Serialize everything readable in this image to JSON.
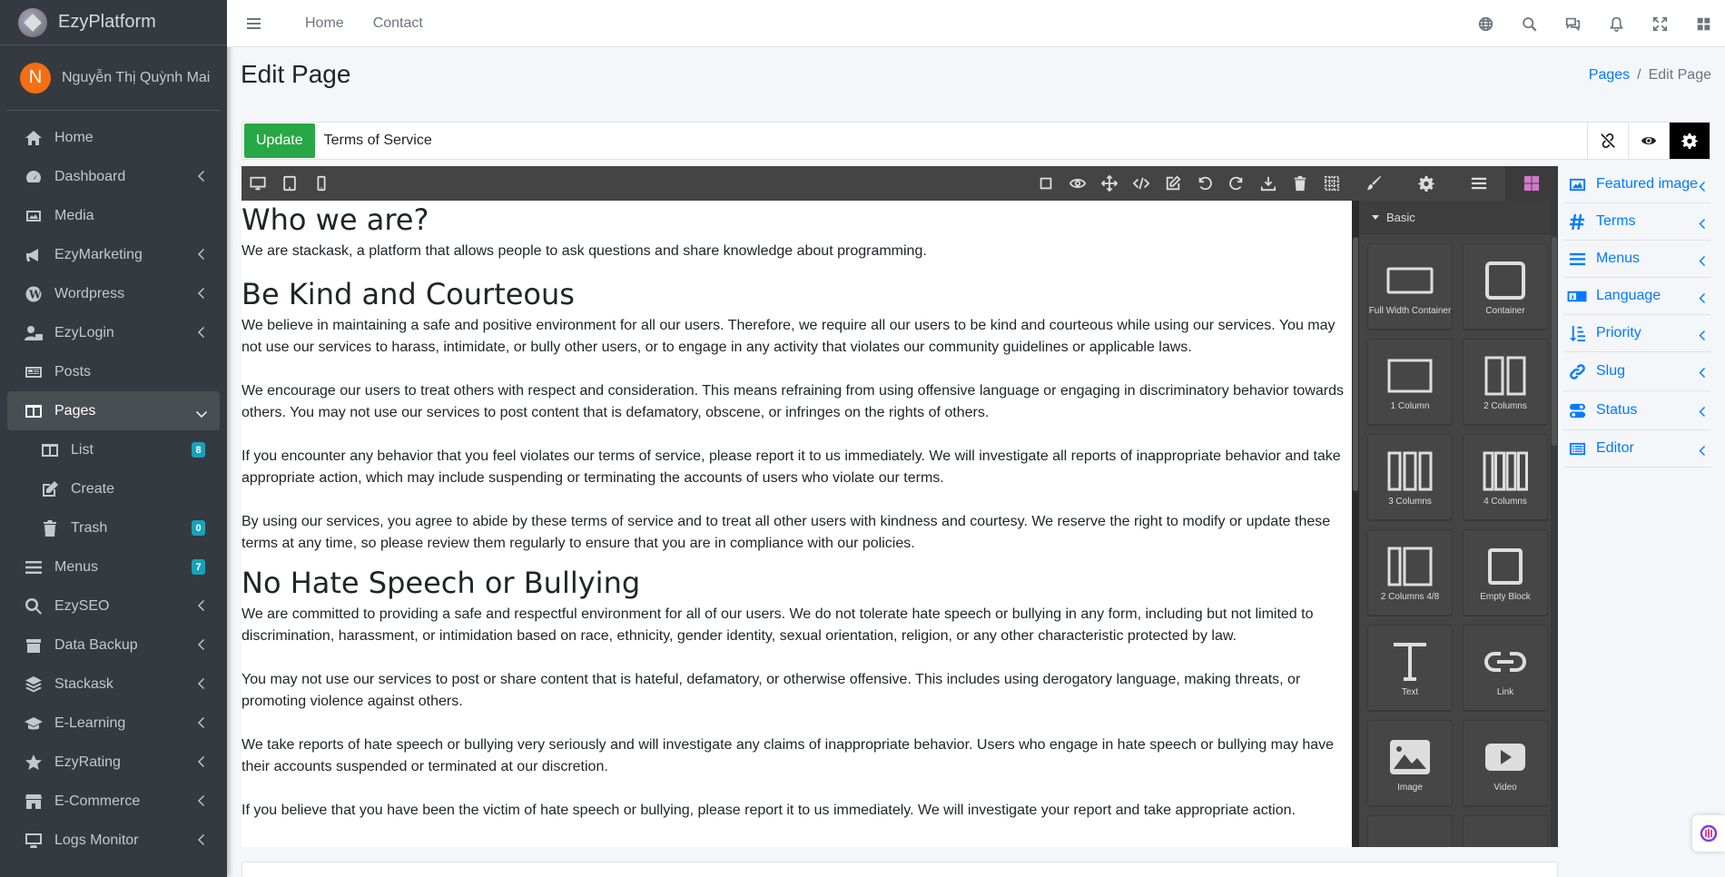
{
  "brand": {
    "name": "EzyPlatform"
  },
  "user": {
    "initial": "N",
    "name": "Nguyễn Thị Quỳnh Mai"
  },
  "sidebar": {
    "items": [
      {
        "label": "Home",
        "icon": "home-icon"
      },
      {
        "label": "Dashboard",
        "icon": "dashboard-icon"
      },
      {
        "label": "Media",
        "icon": "image-icon"
      },
      {
        "label": "EzyMarketing",
        "icon": "megaphone-icon"
      },
      {
        "label": "Wordpress",
        "icon": "wordpress-icon"
      },
      {
        "label": "EzyLogin",
        "icon": "user-lock-icon"
      },
      {
        "label": "Posts",
        "icon": "newspaper-icon"
      },
      {
        "label": "Pages",
        "icon": "columns-icon"
      },
      {
        "label": "List",
        "icon": "list-icon",
        "badge": "8"
      },
      {
        "label": "Create",
        "icon": "edit-icon"
      },
      {
        "label": "Trash",
        "icon": "trash-icon",
        "badge": "0"
      },
      {
        "label": "Menus",
        "icon": "bars-icon",
        "badge": "7"
      },
      {
        "label": "EzySEO",
        "icon": "search-dollar-icon"
      },
      {
        "label": "Data Backup",
        "icon": "box-icon"
      },
      {
        "label": "Stackask",
        "icon": "layers-icon"
      },
      {
        "label": "E-Learning",
        "icon": "graduation-cap-icon"
      },
      {
        "label": "EzyRating",
        "icon": "star-icon"
      },
      {
        "label": "E-Commerce",
        "icon": "store-icon"
      },
      {
        "label": "Logs Monitor",
        "icon": "display-icon"
      }
    ]
  },
  "topbar": {
    "links": [
      "Home",
      "Contact"
    ]
  },
  "page": {
    "title": "Edit Page",
    "breadcrumb": {
      "parent": "Pages",
      "current": "Edit Page"
    }
  },
  "editor_bar": {
    "update_label": "Update",
    "title_value": "Terms of Service"
  },
  "content": {
    "h1_who": "Who we are?",
    "p_who": "We are stackask, a platform that allows people to ask questions and share knowledge about programming.",
    "h1_kind": "Be Kind and Courteous",
    "p_kind_1": "We believe in maintaining a safe and positive environment for all our users. Therefore, we require all our users to be kind and courteous while using our services. You may not use our services to harass, intimidate, or bully other users, or to engage in any activity that violates our community guidelines or applicable laws.",
    "p_kind_2": "We encourage our users to treat others with respect and consideration. This means refraining from using offensive language or engaging in discriminatory behavior towards others. You may not use our services to post content that is defamatory, obscene, or infringes on the rights of others.",
    "p_kind_3": "If you encounter any behavior that you feel violates our terms of service, please report it to us immediately. We will investigate all reports of inappropriate behavior and take appropriate action, which may include suspending or terminating the accounts of users who violate our terms.",
    "p_kind_4": "By using our services, you agree to abide by these terms of service and to treat all other users with kindness and courtesy. We reserve the right to modify or update these terms at any time, so please review them regularly to ensure that you are in compliance with our policies.",
    "h1_hate": "No Hate Speech or Bullying",
    "p_hate_1": "We are committed to providing a safe and respectful environment for all of our users. We do not tolerate hate speech or bullying in any form, including but not limited to discrimination, harassment, or intimidation based on race, ethnicity, gender identity, sexual orientation, religion, or any other characteristic protected by law.",
    "p_hate_2": "You may not use our services to post or share content that is hateful, defamatory, or otherwise offensive. This includes using derogatory language, making threats, or promoting violence against others.",
    "p_hate_3": "We take reports of hate speech or bullying very seriously and will investigate any claims of inappropriate behavior. Users who engage in hate speech or bullying may have their accounts suspended or terminated at our discretion.",
    "p_hate_4": "If you believe that you have been the victim of hate speech or bullying, please report it to us immediately. We will investigate your report and take appropriate action."
  },
  "blocks": {
    "category": "Basic",
    "items": [
      {
        "label": "Full Width Container"
      },
      {
        "label": "Container"
      },
      {
        "label": "1 Column"
      },
      {
        "label": "2 Columns"
      },
      {
        "label": "3 Columns"
      },
      {
        "label": "4 Columns"
      },
      {
        "label": "2 Columns 4/8"
      },
      {
        "label": "Empty Block"
      },
      {
        "label": "Text"
      },
      {
        "label": "Link"
      },
      {
        "label": "Image"
      },
      {
        "label": "Video"
      }
    ]
  },
  "settings_panel": {
    "items": [
      "Featured image",
      "Terms",
      "Menus",
      "Language",
      "Priority",
      "Slug",
      "Status",
      "Editor"
    ]
  },
  "colors": {
    "sidebar_bg": "#343a40",
    "accent": "#007bff",
    "update_green": "#28a745",
    "badge": "#17a2b8",
    "editor_dark": "#444444",
    "active_layer": "#d278c9"
  }
}
